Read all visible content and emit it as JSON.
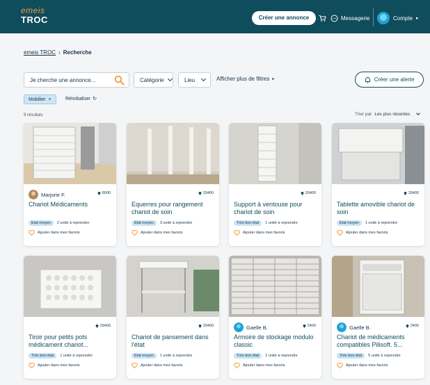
{
  "header": {
    "logo_top": "emeis",
    "logo_bottom": "TROC",
    "create_label": "Créer une annonce",
    "messaging_label": "Messagerie",
    "account_label": "Compte"
  },
  "breadcrumb": {
    "home": "emeis TROC",
    "separator": "›",
    "current": "Recherche"
  },
  "search": {
    "placeholder": "Je cherche une annonce...",
    "category_label": "Catégorie",
    "location_label": "Lieu",
    "more_filters_label": "Afficher plus de filtres",
    "alert_label": "Créer une alerte"
  },
  "filters": {
    "active_chip": "Mobilier",
    "chip_close": "×",
    "reset_label": "Réinitialiser"
  },
  "results": {
    "count_label": "9 résultats",
    "sort_prefix": "Trier par",
    "sort_value": "Les plus récentes"
  },
  "favorite_label": "Ajouter dans mes favoris",
  "listings": [
    {
      "seller": "Marjorie F.",
      "location": "8000",
      "title": "Chariot Médicaments",
      "condition": "Etat moyen",
      "units": "2 unité à reprendre"
    },
    {
      "seller": "",
      "location": "33400",
      "title": "Equerres pour rangement chariot de soin",
      "condition": "Etat moyen",
      "units": "3 unité à reprendre"
    },
    {
      "seller": "",
      "location": "33400",
      "title": "Support à ventouse pour chariot de soin",
      "condition": "Très bon état",
      "units": "1 unité à reprendre"
    },
    {
      "seller": "",
      "location": "33400",
      "title": "Tablette amovible chariot de soin",
      "condition": "Etat moyen",
      "units": "1 unité à reprendre"
    },
    {
      "seller": "",
      "location": "33400",
      "title": "Tiroir pour petits pots médicament chariot...",
      "condition": "Très bon état",
      "units": "1 unité à reprendre"
    },
    {
      "seller": "",
      "location": "33400",
      "title": "Chariot de pansement dans l'état",
      "condition": "Etat moyen",
      "units": "1 unité à reprendre"
    },
    {
      "seller": "Gaelle B.",
      "location": "2400",
      "title": "Armoire de stockage modulo classic",
      "condition": "Très bon état",
      "units": "2 unité à reprendre"
    },
    {
      "seller": "Gaelle B.",
      "location": "2400",
      "title": "Chariot de médicaments compatibles Pilisoft. 5...",
      "condition": "Très bon état",
      "units": "5 unité à reprendre"
    }
  ],
  "colors": {
    "header_bg": "#0f4c5c",
    "accent_orange": "#f29a3a",
    "badge_bg": "#c8e3f4"
  }
}
